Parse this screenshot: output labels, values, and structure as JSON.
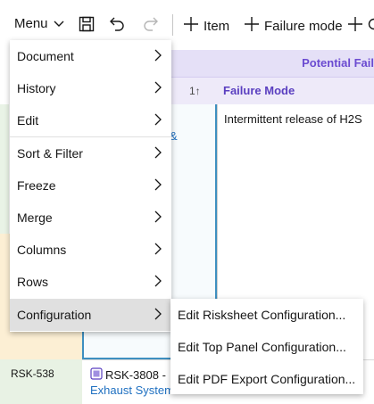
{
  "toolbar": {
    "menu_label": "Menu",
    "item_label": "Item",
    "failure_mode_label": "Failure mode"
  },
  "menu": {
    "items": [
      {
        "label": "Document"
      },
      {
        "label": "History"
      },
      {
        "label": "Edit"
      },
      {
        "label": "Sort & Filter"
      },
      {
        "label": "Freeze"
      },
      {
        "label": "Merge"
      },
      {
        "label": "Columns"
      },
      {
        "label": "Rows"
      },
      {
        "label": "Configuration"
      }
    ],
    "active": "Configuration"
  },
  "submenu": {
    "items": [
      {
        "label": "Edit Risksheet Configuration..."
      },
      {
        "label": "Edit Top Panel Configuration..."
      },
      {
        "label": "Edit PDF Export Configuration..."
      }
    ]
  },
  "sheet": {
    "group_title": "Potential Fail",
    "sort_indicator": "1↑",
    "column_failure_mode": "Failure Mode",
    "failure_mode_value": "Intermittent release of H2S",
    "amp": "&",
    "row_left_id": "RSK-538",
    "row_mid_id": "RSK-3808 -",
    "row_mid_link": "Exhaust System"
  },
  "colors": {
    "accent_purple": "#6b4bd1",
    "link_blue": "#1f70c1",
    "header_bg": "#e5e0f7",
    "active_item_bg": "#e0e0e0"
  }
}
